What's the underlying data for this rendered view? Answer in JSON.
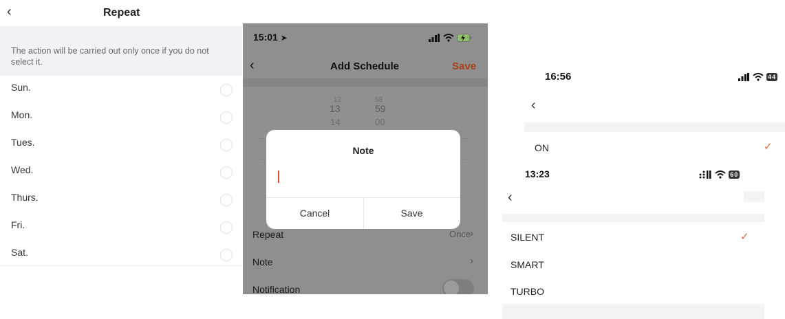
{
  "repeat": {
    "title": "Repeat",
    "back_icon": "chevron-left-icon",
    "hint": "The action will be carried out only once if you do not select it.",
    "days": [
      "Sun.",
      "Mon.",
      "Tues.",
      "Wed.",
      "Thurs.",
      "Fri.",
      "Sat."
    ]
  },
  "schedule": {
    "status_time": "15:01",
    "status_icons": "signal-wifi-battery-icons",
    "title": "Add Schedule",
    "save_label": "Save",
    "picker": {
      "hours": [
        "12",
        "13",
        "14"
      ],
      "minutes": [
        "58",
        "59",
        "00"
      ]
    },
    "rows": [
      {
        "label": "Repeat",
        "value": "Once"
      },
      {
        "label": "Note",
        "value": ""
      },
      {
        "label": "Notification",
        "value": ""
      }
    ],
    "dialog": {
      "title": "Note",
      "input_value": "",
      "cancel_label": "Cancel",
      "save_label": "Save"
    }
  },
  "power": {
    "status_time": "16:56",
    "battery": "44",
    "option": "ON"
  },
  "mode": {
    "status_time": "13:23",
    "battery": "60",
    "options": [
      "SILENT",
      "SMART",
      "TURBO"
    ],
    "selected": "SILENT",
    "accent_color": "#e46b3c"
  }
}
